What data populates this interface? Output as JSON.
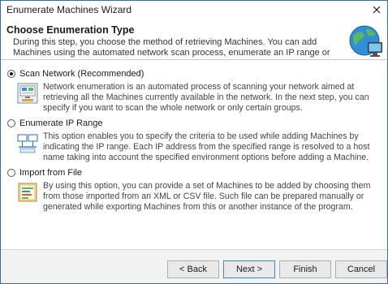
{
  "window": {
    "title": "Enumerate Machines Wizard"
  },
  "header": {
    "title": "Choose Enumeration Type",
    "description": "During this step, you choose the method of retrieving Machines. You can add Machines using the automated network scan process, enumerate an IP range or import Machines from a file."
  },
  "options": [
    {
      "label": "Scan Network (Recommended)",
      "selected": true,
      "icon": "network-scan-icon",
      "description": "Network enumeration is an automated process of scanning your network aimed at retrieving all the Machines currently available in the network. In the next step, you can specify if you want to scan the whole network or only certain groups."
    },
    {
      "label": "Enumerate IP Range",
      "selected": false,
      "icon": "ip-range-icon",
      "description": "This option enables you to specify the criteria to be used while adding Machines by indicating the IP range. Each IP address from the specified range is resolved to a host name taking into account the specified environment options before adding a Machine."
    },
    {
      "label": "Import from File",
      "selected": false,
      "icon": "import-file-icon",
      "description": "By using this option, you can provide a set of Machines to be added by choosing them from those imported from an XML or CSV file. Such file can be prepared manually or generated while exporting Machines from this or another instance of the program."
    }
  ],
  "footer": {
    "back_label": "< Back",
    "next_label": "Next >",
    "finish_label": "Finish",
    "cancel_label": "Cancel"
  },
  "colors": {
    "window_border": "#2f6fb6",
    "footer_bg": "#f2f2f2",
    "default_button_border": "#3b86d6"
  }
}
